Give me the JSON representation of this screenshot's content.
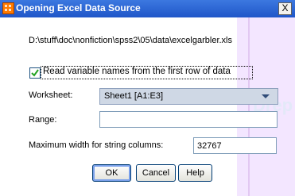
{
  "window": {
    "title": "Opening Excel Data Source",
    "close_glyph": "X"
  },
  "file_path": "D:\\stuff\\doc\\nonfiction\\spss2\\05\\data\\excelgarbler.xls",
  "first_row_checkbox": {
    "label": "Read variable names from the first row of data",
    "checked": true
  },
  "worksheet": {
    "label": "Worksheet:",
    "selected": "Sheet1 [A1:E3]"
  },
  "range": {
    "label": "Range:",
    "value": ""
  },
  "max_width": {
    "label": "Maximum width for string columns:",
    "value": "32767"
  },
  "buttons": {
    "ok": "OK",
    "cancel": "Cancel",
    "help": "Help"
  },
  "background": {
    "watermark_text": "Drep"
  }
}
